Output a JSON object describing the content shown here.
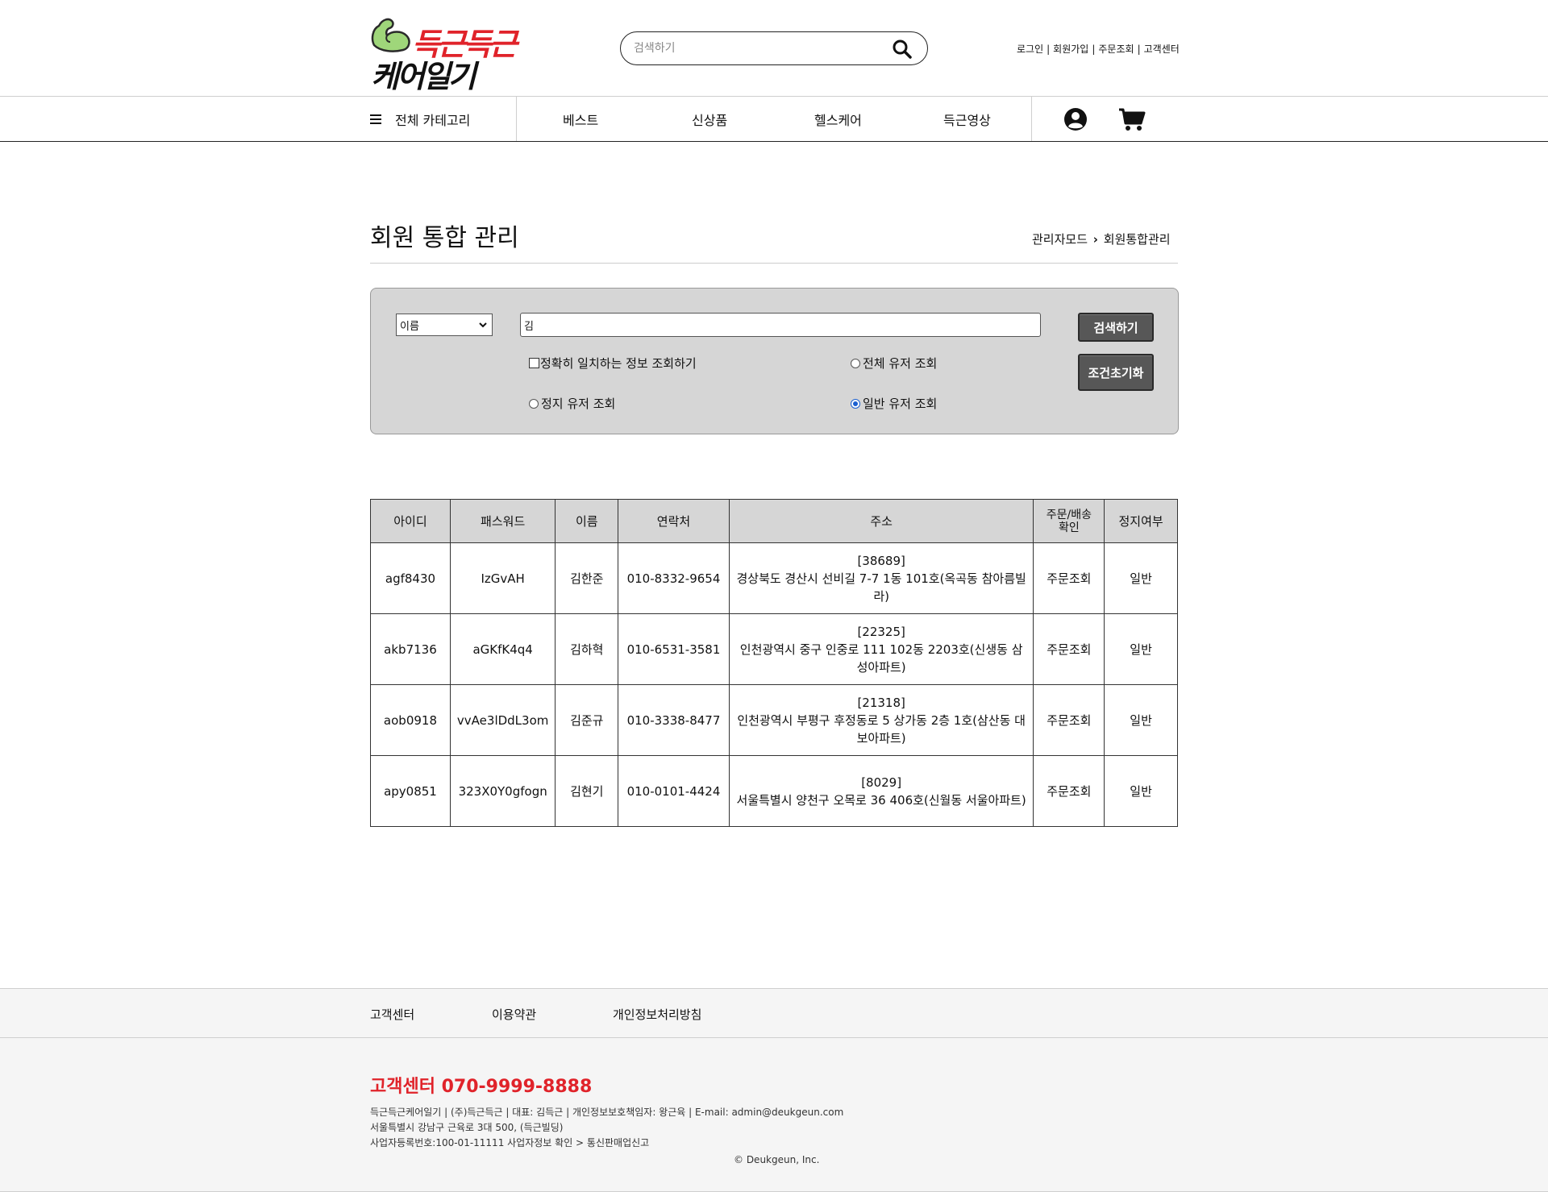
{
  "brand": {
    "logo_top": "득근득근",
    "logo_bottom": "케어일기",
    "logo_top_color": "#e0232a"
  },
  "search": {
    "placeholder": "검색하기",
    "icon": "search-icon"
  },
  "top_links": [
    "로그인",
    "회원가입",
    "주문조회",
    "고객센터"
  ],
  "nav": {
    "category_label": "전체 카테고리",
    "items": [
      "베스트",
      "신상품",
      "헬스케어",
      "득근영상"
    ],
    "icons": [
      "user-icon",
      "cart-icon"
    ]
  },
  "page": {
    "title": "회원 통합 관리",
    "breadcrumb": [
      "관리자모드",
      "회원통합관리"
    ]
  },
  "filter": {
    "select_value": "이름",
    "keyword": "김",
    "exact_match_label": "정확히 일치하는 정보 조회하기",
    "exact_match_checked": false,
    "radio_all_label": "전체 유저 조회",
    "radio_suspended_label": "정지 유저 조회",
    "radio_normal_label": "일반 유저 조회",
    "selected_radio": "일반 유저 조회",
    "search_button": "검색하기",
    "reset_button": "조건초기화",
    "panel_color": "#d6d6d6",
    "button_color": "#575757"
  },
  "table": {
    "headers": [
      "아이디",
      "패스워드",
      "이름",
      "연락처",
      "주소",
      "주문/배송\n확인",
      "정지여부"
    ],
    "rows": [
      {
        "id": "agf8430",
        "password": "IzGvAH",
        "name": "김한준",
        "phone": "010-8332-9654",
        "zip": "[38689]",
        "address": "경상북도 경산시 선비길 7-7 1동 101호(옥곡동 참아름빌라)",
        "order": "주문조회",
        "status": "일반"
      },
      {
        "id": "akb7136",
        "password": "aGKfK4q4",
        "name": "김하혁",
        "phone": "010-6531-3581",
        "zip": "[22325]",
        "address": "인천광역시 중구 인중로 111 102동 2203호(신생동 삼성아파트)",
        "order": "주문조회",
        "status": "일반"
      },
      {
        "id": "aob0918",
        "password": "vvAe3lDdL3om",
        "name": "김준규",
        "phone": "010-3338-8477",
        "zip": "[21318]",
        "address": "인천광역시 부평구 후정동로 5 상가동 2층 1호(삼산동 대보아파트)",
        "order": "주문조회",
        "status": "일반"
      },
      {
        "id": "apy0851",
        "password": "323X0Y0gfogn",
        "name": "김현기",
        "phone": "010-0101-4424",
        "zip": "[8029]",
        "address": "서울특별시 양천구 오목로 36 406호(신월동 서울아파트)",
        "order": "주문조회",
        "status": "일반"
      }
    ]
  },
  "footer": {
    "links": [
      "고객센터",
      "이용약관",
      "개인정보처리방침"
    ],
    "cs_phone": "고객센터 070-9999-8888",
    "info_line1": "득근득근케어일기 | (주)득근득근 | 대표: 김득근 | 개인정보보호책임자: 왕근육 | E-mail: admin@deukgeun.com",
    "info_line2": "서울특별시 강남구 근육로 3대 500, (득근빌딩)",
    "info_line3": "사업자등록번호:100-01-11111 사업자정보 확인 > 통신판매업신고",
    "copyright": "© Deukgeun, Inc."
  }
}
